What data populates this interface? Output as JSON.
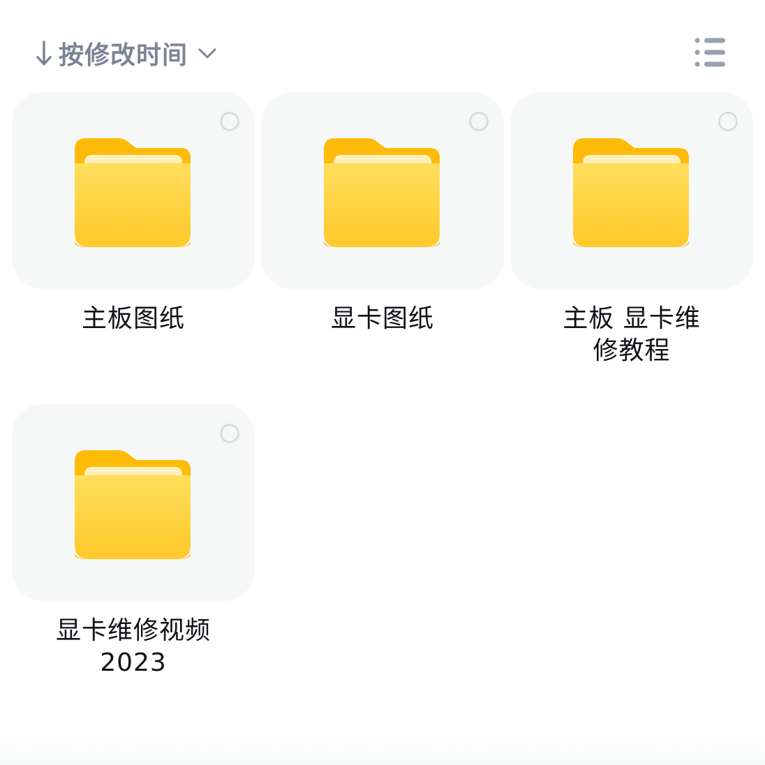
{
  "toolbar": {
    "sort_label": "按修改时间",
    "sort_icon": "arrow-down-icon",
    "dropdown_icon": "chevron-down-icon",
    "view_icon": "list-view-icon"
  },
  "folders": [
    {
      "name": "主板图纸",
      "icon": "folder-icon"
    },
    {
      "name": "显卡图纸",
      "icon": "folder-icon"
    },
    {
      "name": "主板 显卡维修教程",
      "icon": "folder-icon"
    },
    {
      "name": "显卡维修视频2023",
      "icon": "folder-icon"
    }
  ],
  "colors": {
    "folder_body": "#ffd449",
    "folder_tab": "#ffbe0b",
    "card_bg": "#f6f8f8",
    "toolbar_text": "#7c8496"
  }
}
